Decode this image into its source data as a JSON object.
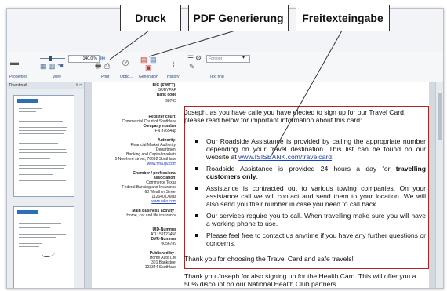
{
  "callouts": {
    "print": "Druck",
    "pdf": "PDF Generierung",
    "freetext": "Freitexteingabe"
  },
  "ribbon": {
    "zoom_value": "140.0 %",
    "font_placeholder": "Fontour",
    "groups": [
      "Properties",
      "View",
      "Print",
      "Optio...",
      "Generation",
      "History",
      "Text find"
    ]
  },
  "thumbnails": {
    "title": "Thumbnail",
    "pin_icons": "# ×"
  },
  "sidebar": {
    "bic_label": "BIC (SWIFT):",
    "bic_value": "SUBYPAP",
    "bank_code_label": "Bank code",
    "bank_code_value": "98765",
    "register_court_label": "Register court:",
    "register_court_value": "Commercial Court of Southlake",
    "company_number_label": "Company number",
    "company_number_value": "FN 87654ap",
    "authority_label": "Authority:",
    "authority_line1": "Financial Market Authority,",
    "authority_line2": "Department",
    "authority_line3": "Banking and Capital markets",
    "authority_line4": "5 Nowhere street, 76092 Southlake",
    "authority_link": "www.fma.gv.com",
    "chamber_label1": "Chamber / professional",
    "chamber_label2": "association:",
    "chamber_line1": "Commerce Texas",
    "chamber_line2": "Federal Banking and Insurance",
    "chamber_line3": "63 Weather Street",
    "chamber_line4": "112640 Dallas",
    "chamber_link": "www.wko.com",
    "main_business_label1": "Main Business activity :",
    "main_business_label2": "Home, car and life insurance",
    "uid_label": "UID-Nummer",
    "uid_value": "ATU 51123456",
    "dvr_label": "DVR-Nummer",
    "dvr_value": "0056789",
    "published_label": "Published by :",
    "published_line1": "Home Auto Life",
    "published_line2": "301 Banksteet",
    "published_line3": "123344 Southlake"
  },
  "letter": {
    "intro_line1": "Joseph, as you have calle you have elected to sign up for our Travel Card,",
    "intro_line2": "please read below for important information about this card:",
    "bullet1_text": "Our Roadside Assistance is provided by calling the appropriate number depending on your travel destination. This list can be found on our website at ",
    "bullet1_link": "www.ISISBANK.com/travelcard",
    "bullet1_end": ".",
    "bullet2_text": "Roadside Assistance is provided 24 hours a day for ",
    "bullet2_bold": "travelling customers only",
    "bullet2_end": ".",
    "bullet3_text": "Assistance is contracted out to various towing companies. On your assistance call we will contact and send them to your location. We will also send you their number in case you need to call back.",
    "bullet4_text": "Our services require you to call. When travelling make sure you will have a working phone to use.",
    "bullet5_text": "Please feel free to contact us anytime if you have any further questions or concerns.",
    "closing": "Thank you for choosing the Travel Card and safe travels!",
    "health_line1": "Thank you Joseph for also signing up for the Health Card. This will offer you a",
    "health_line2": "50% discount on our National Health Club partners."
  },
  "colors": {
    "textbox_border": "#b22222",
    "link": "#1a3fbf",
    "ribbon_label": "#2b4a7a"
  }
}
